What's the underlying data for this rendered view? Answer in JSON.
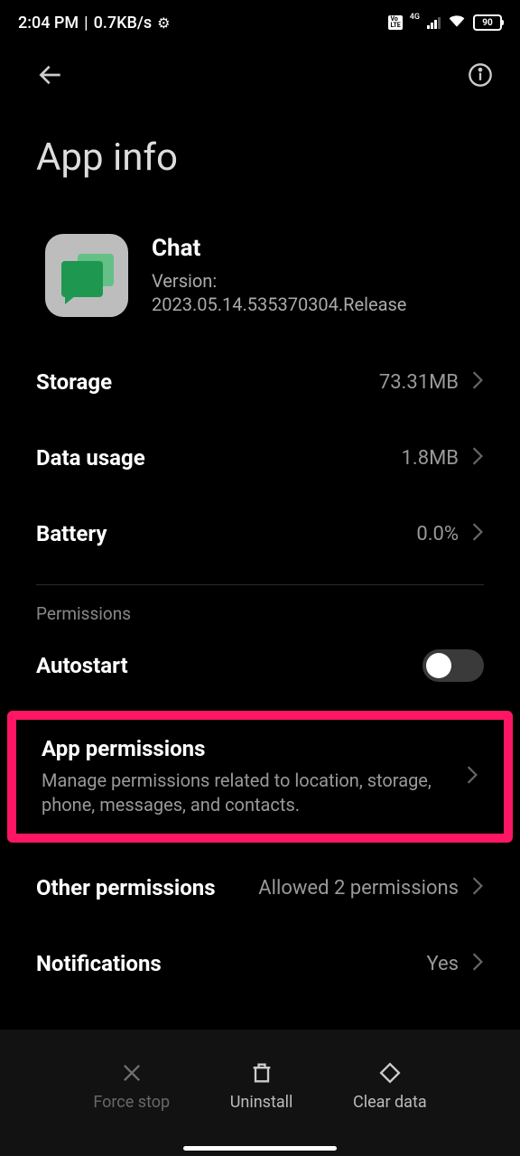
{
  "status": {
    "time": "2:04 PM",
    "speed": "0.7KB/s",
    "network_type": "4G",
    "battery": "90"
  },
  "header": {
    "title": "App info"
  },
  "app": {
    "name": "Chat",
    "version_label": "Version:",
    "version": "2023.05.14.535370304.Release"
  },
  "items": {
    "storage": {
      "label": "Storage",
      "value": "73.31MB"
    },
    "data_usage": {
      "label": "Data usage",
      "value": "1.8MB"
    },
    "battery": {
      "label": "Battery",
      "value": "0.0%"
    }
  },
  "permissions": {
    "section_label": "Permissions",
    "autostart": {
      "label": "Autostart"
    },
    "app_permissions": {
      "label": "App permissions",
      "desc": "Manage permissions related to location, storage, phone, messages, and contacts."
    },
    "other": {
      "label": "Other permissions",
      "value": "Allowed 2 permissions"
    },
    "notifications": {
      "label": "Notifications",
      "value": "Yes"
    }
  },
  "footer": {
    "force_stop": "Force stop",
    "uninstall": "Uninstall",
    "clear_data": "Clear data"
  }
}
